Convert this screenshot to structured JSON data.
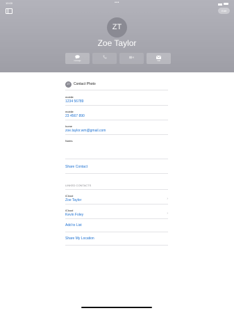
{
  "status": {
    "time": "10:00",
    "dots": "•••"
  },
  "header": {
    "edit_label": "Edit",
    "initials": "ZT",
    "name": "Zoe Taylor",
    "actions": [
      {
        "label": "message",
        "icon": "message-icon"
      },
      {
        "label": "",
        "icon": "phone-icon"
      },
      {
        "label": "",
        "icon": "video-icon"
      },
      {
        "label": "mail",
        "icon": "mail-icon"
      }
    ]
  },
  "contact": {
    "photo_initials": "ZT",
    "photo_label": "Contact Photo",
    "phones": [
      {
        "label": "mobile",
        "value": "1234 56789"
      },
      {
        "label": "mobile",
        "value": "23 4567 890"
      }
    ],
    "email": {
      "label": "home",
      "value": "zoe.taylor.wm@gmail.com"
    },
    "notes_label": "Notes",
    "share_contact": "Share Contact",
    "linked_title": "LINKED CONTACTS",
    "linked": [
      {
        "source": "iCloud",
        "name": "Zoe Taylor"
      },
      {
        "source": "iCloud",
        "name": "Kevin Foley"
      }
    ],
    "add_to_list": "Add to List",
    "share_location": "Share My Location"
  }
}
